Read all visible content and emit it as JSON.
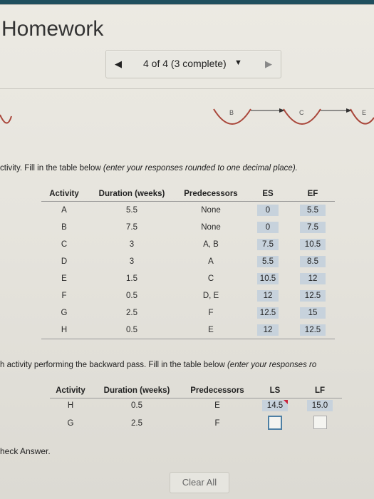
{
  "header": {
    "title": "Homework"
  },
  "nav": {
    "label": "4 of 4 (3 complete)"
  },
  "diagram": {
    "nodes": [
      "B",
      "C",
      "E"
    ]
  },
  "forward": {
    "instructions_plain": "ctivity. Fill in the table below ",
    "instructions_em": "(enter your responses rounded to one decimal place).",
    "headers": [
      "Activity",
      "Duration (weeks)",
      "Predecessors",
      "ES",
      "EF"
    ],
    "rows": [
      [
        "A",
        "5.5",
        "None",
        "0",
        "5.5"
      ],
      [
        "B",
        "7.5",
        "None",
        "0",
        "7.5"
      ],
      [
        "C",
        "3",
        "A, B",
        "7.5",
        "10.5"
      ],
      [
        "D",
        "3",
        "A",
        "5.5",
        "8.5"
      ],
      [
        "E",
        "1.5",
        "C",
        "10.5",
        "12"
      ],
      [
        "F",
        "0.5",
        "D, E",
        "12",
        "12.5"
      ],
      [
        "G",
        "2.5",
        "F",
        "12.5",
        "15"
      ],
      [
        "H",
        "0.5",
        "E",
        "12",
        "12.5"
      ]
    ]
  },
  "backward": {
    "instructions_plain": "h activity performing the backward pass. Fill in the table below ",
    "instructions_em": "(enter your responses ro",
    "headers": [
      "Activity",
      "Duration (weeks)",
      "Predecessors",
      "LS",
      "LF"
    ],
    "rows": [
      [
        "H",
        "0.5",
        "E",
        "14.5",
        "15.0"
      ],
      [
        "G",
        "2.5",
        "F",
        "",
        ""
      ]
    ]
  },
  "footer": {
    "check_answer": "heck Answer.",
    "clear_all": "Clear All"
  }
}
